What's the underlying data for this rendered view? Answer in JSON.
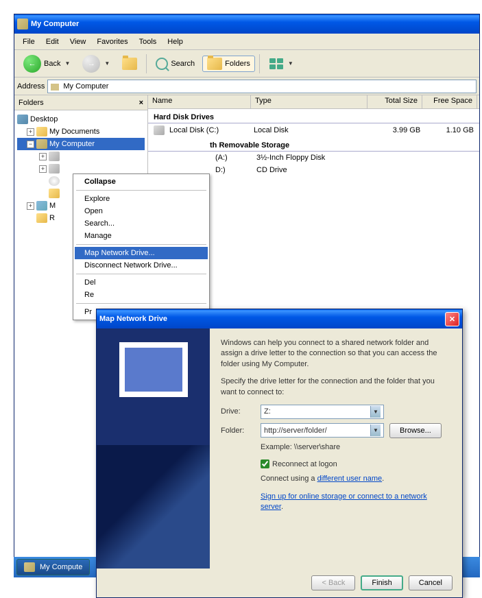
{
  "window": {
    "title": "My Computer"
  },
  "menubar": [
    "File",
    "Edit",
    "View",
    "Favorites",
    "Tools",
    "Help"
  ],
  "toolbar": {
    "back": "Back",
    "search": "Search",
    "folders": "Folders"
  },
  "address": {
    "label": "Address",
    "value": "My Computer"
  },
  "folders_panel": {
    "title": "Folders"
  },
  "tree": {
    "desktop": "Desktop",
    "documents": "My Documents",
    "computer": "My Computer",
    "network": "M",
    "recycle": "R"
  },
  "columns": {
    "name": "Name",
    "type": "Type",
    "size": "Total Size",
    "free": "Free Space"
  },
  "groups": {
    "hdd": "Hard Disk Drives",
    "removable": "th Removable Storage"
  },
  "drives": {
    "local": {
      "name": "Local Disk (C:)",
      "type": "Local Disk",
      "size": "3.99 GB",
      "free": "1.10 GB"
    },
    "floppy": {
      "name": "(A:)",
      "type": "3½-Inch Floppy Disk"
    },
    "cd": {
      "name": "D:)",
      "type": "CD Drive"
    }
  },
  "context": {
    "collapse": "Collapse",
    "explore": "Explore",
    "open": "Open",
    "search": "Search...",
    "manage": "Manage",
    "map": "Map Network Drive...",
    "disconnect": "Disconnect Network Drive...",
    "del": "Del",
    "re": "Re",
    "pr": "Pr"
  },
  "dialog": {
    "title": "Map Network Drive",
    "intro": "Windows can help you connect to a shared network folder and assign a drive letter to the connection so that you can access the folder using My Computer.",
    "specify": "Specify the drive letter for the connection and the folder that you want to connect to:",
    "drive_label": "Drive:",
    "drive_value": "Z:",
    "folder_label": "Folder:",
    "folder_value": "http://server/folder/",
    "browse": "Browse...",
    "example": "Example: \\\\server\\share",
    "reconnect": "Reconnect at logon",
    "connect_using": "Connect using a ",
    "different_user": "different user name",
    "signup": "Sign up for online storage or connect to a network server",
    "back": "< Back",
    "finish": "Finish",
    "cancel": "Cancel"
  },
  "taskbar": {
    "mycomputer": "My Compute"
  }
}
